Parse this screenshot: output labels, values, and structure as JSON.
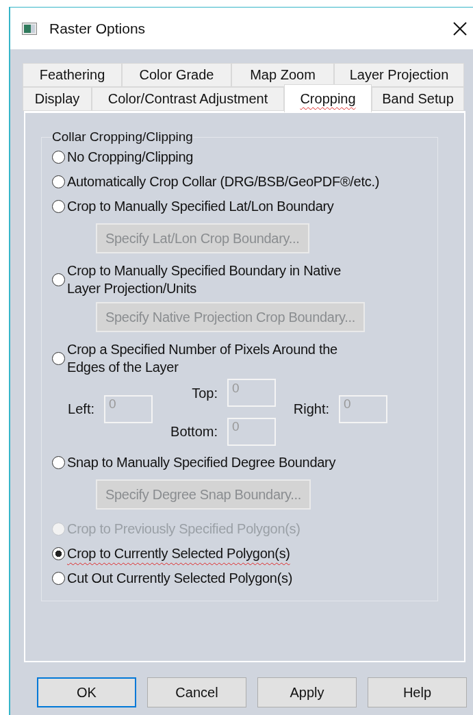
{
  "window": {
    "title": "Raster Options"
  },
  "tabs": [
    [
      {
        "label": "Feathering",
        "selected": false
      },
      {
        "label": "Color Grade",
        "selected": false
      },
      {
        "label": "Map Zoom",
        "selected": false
      },
      {
        "label": "Layer Projection",
        "selected": false
      }
    ],
    [
      {
        "label": "Display",
        "selected": false
      },
      {
        "label": "Color/Contrast Adjustment",
        "selected": false
      },
      {
        "label": "Cropping",
        "selected": true
      },
      {
        "label": "Band Setup",
        "selected": false
      }
    ]
  ],
  "group": {
    "title": "Collar Cropping/Clipping",
    "items": [
      {
        "kind": "radio",
        "label": "No Cropping/Clipping",
        "selected": false,
        "disabled": false
      },
      {
        "kind": "radio",
        "label": "Automatically Crop Collar (DRG/BSB/GeoPDF®/etc.)",
        "selected": false,
        "disabled": false
      },
      {
        "kind": "radio",
        "label": "Crop to Manually Specified Lat/Lon Boundary",
        "selected": false,
        "disabled": false
      },
      {
        "kind": "button",
        "label": "Specify Lat/Lon Crop Boundary...",
        "disabled": true
      },
      {
        "kind": "radio",
        "label": "Crop to Manually Specified Boundary in Native Layer Projection/Units",
        "selected": false,
        "disabled": false
      },
      {
        "kind": "button",
        "label": "Specify Native Projection Crop Boundary...",
        "disabled": true
      },
      {
        "kind": "radio",
        "label": "Crop a Specified Number of Pixels Around the Edges of the Layer",
        "selected": false,
        "disabled": false
      },
      {
        "kind": "margins",
        "fields": [
          {
            "label": "Left:",
            "value": "0"
          },
          {
            "label": "Top:",
            "value": "0"
          },
          {
            "label": "Right:",
            "value": "0"
          },
          {
            "label": "Bottom:",
            "value": "0"
          }
        ]
      },
      {
        "kind": "radio",
        "label": "Snap to Manually Specified Degree Boundary",
        "selected": false,
        "disabled": false
      },
      {
        "kind": "button",
        "label": "Specify Degree Snap Boundary...",
        "disabled": true
      },
      {
        "kind": "radio",
        "label": "Crop to Previously Specified Polygon(s)",
        "selected": false,
        "disabled": true
      },
      {
        "kind": "radio",
        "label": "Crop to Currently Selected Polygon(s)",
        "selected": true,
        "disabled": false
      },
      {
        "kind": "radio",
        "label": "Cut Out Currently Selected Polygon(s)",
        "selected": false,
        "disabled": false
      }
    ]
  },
  "buttons": [
    {
      "label": "OK",
      "focused": true
    },
    {
      "label": "Cancel",
      "focused": false
    },
    {
      "label": "Apply",
      "focused": false
    },
    {
      "label": "Help",
      "focused": false
    }
  ]
}
